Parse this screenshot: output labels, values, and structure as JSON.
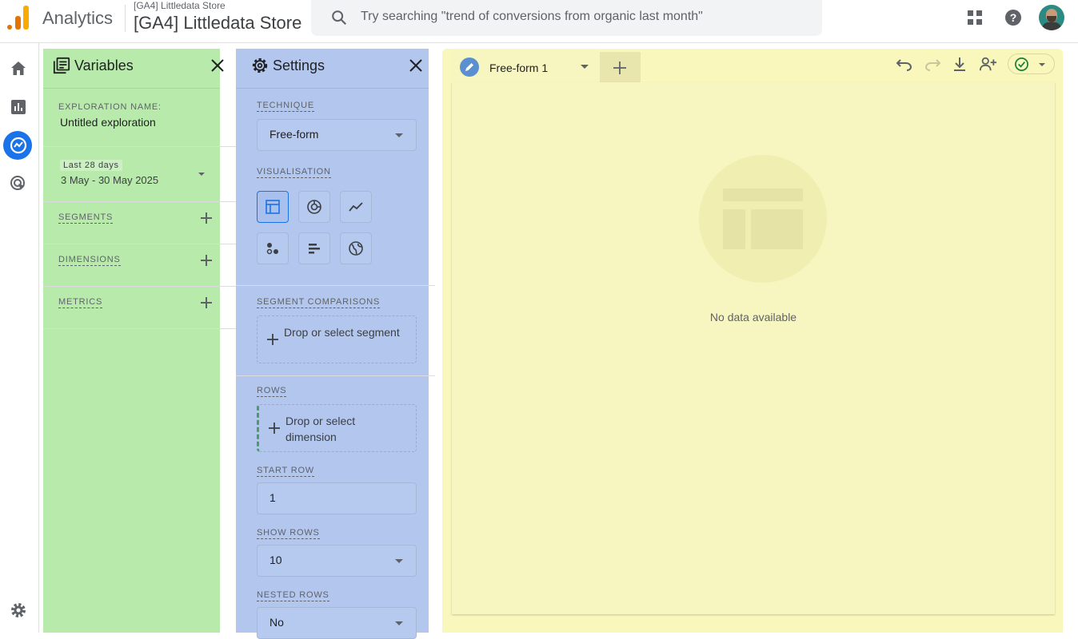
{
  "header": {
    "app_name": "Analytics",
    "account_small": "[GA4] Littledata Store",
    "account_big": "[GA4] Littledata Store",
    "search_placeholder": "Try searching \"trend of conversions from organic last month\""
  },
  "variables": {
    "title": "Variables",
    "exploration_name_label": "EXPLORATION NAME:",
    "exploration_name": "Untitled exploration",
    "date_chip": "Last 28 days",
    "date_range": "3 May - 30 May 2025",
    "segments_label": "SEGMENTS",
    "dimensions_label": "DIMENSIONS",
    "metrics_label": "METRICS"
  },
  "settings": {
    "title": "Settings",
    "technique_label": "TECHNIQUE",
    "technique_value": "Free-form",
    "visualisation_label": "VISUALISATION",
    "segment_comparisons_label": "SEGMENT COMPARISONS",
    "segment_drop": "Drop or select segment",
    "rows_label": "ROWS",
    "rows_drop": "Drop or select dimension",
    "start_row_label": "START ROW",
    "start_row_value": "1",
    "show_rows_label": "SHOW ROWS",
    "show_rows_value": "10",
    "nested_rows_label": "NESTED ROWS",
    "nested_rows_value": "No"
  },
  "canvas": {
    "tab_label": "Free-form 1",
    "empty_message": "No data available"
  },
  "icons": {
    "visualisations": [
      "table-icon",
      "donut-chart-icon",
      "line-chart-icon",
      "scatter-plot-icon",
      "bar-chart-icon",
      "geo-map-icon"
    ],
    "toolbar": [
      "undo-icon",
      "redo-icon",
      "download-icon",
      "share-icon",
      "check-circle-icon"
    ]
  },
  "colors": {
    "variables_panel": "#b8ebab",
    "settings_panel": "#b2c6ee",
    "canvas": "#f9f7bb",
    "accent": "#1a73e8"
  }
}
